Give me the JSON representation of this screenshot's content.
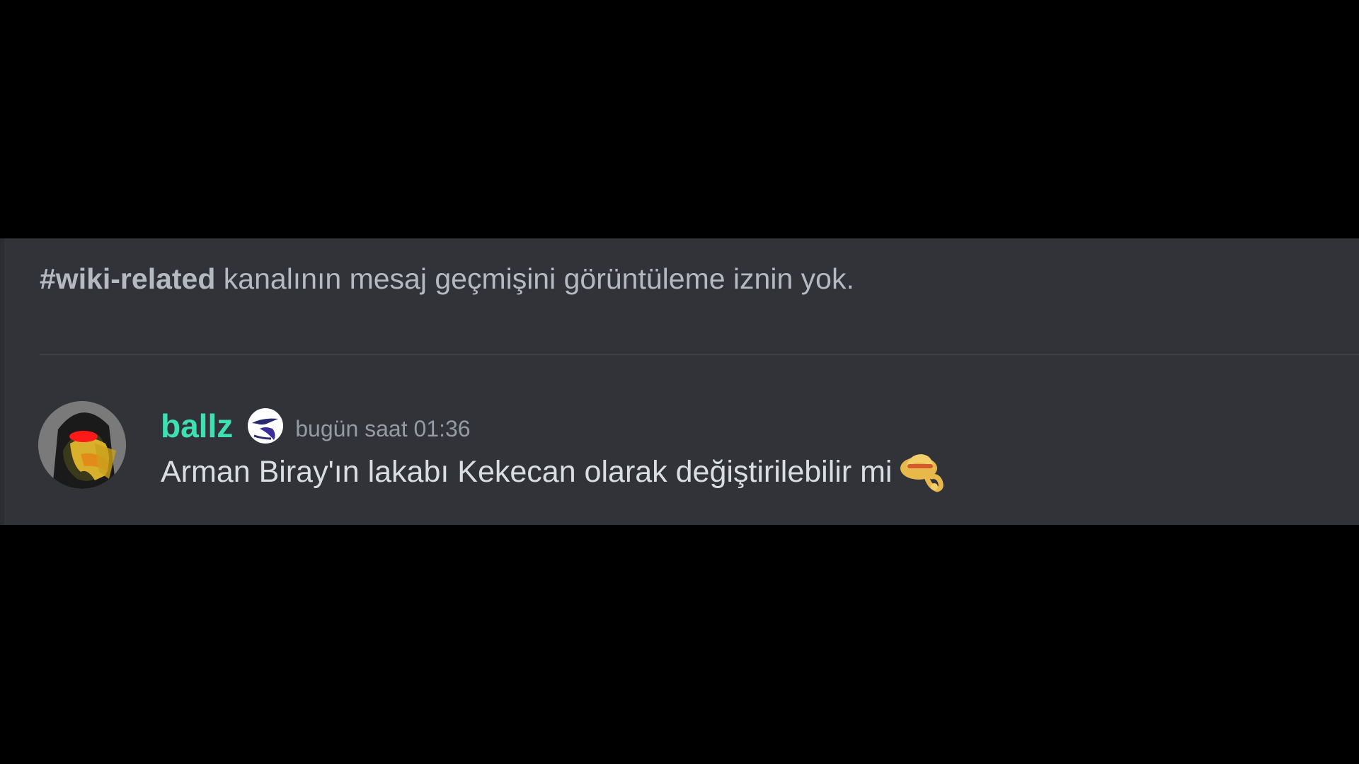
{
  "notice": {
    "channel": "#wiki-related",
    "text": " kanalının mesaj geçmişini görüntüleme iznin yok."
  },
  "message": {
    "username": "ballz",
    "badge_icon": "bird-badge-icon",
    "timestamp": "bugün saat 01:36",
    "content": "Arman Biray'ın lakabı Kekecan olarak değiştirilebilir mi",
    "emoji_icon": "hat-emoji-icon"
  },
  "colors": {
    "background": "#000000",
    "panel": "#313338",
    "username": "#3ee0b2",
    "text": "#dbdee1",
    "muted": "#949ba4"
  }
}
